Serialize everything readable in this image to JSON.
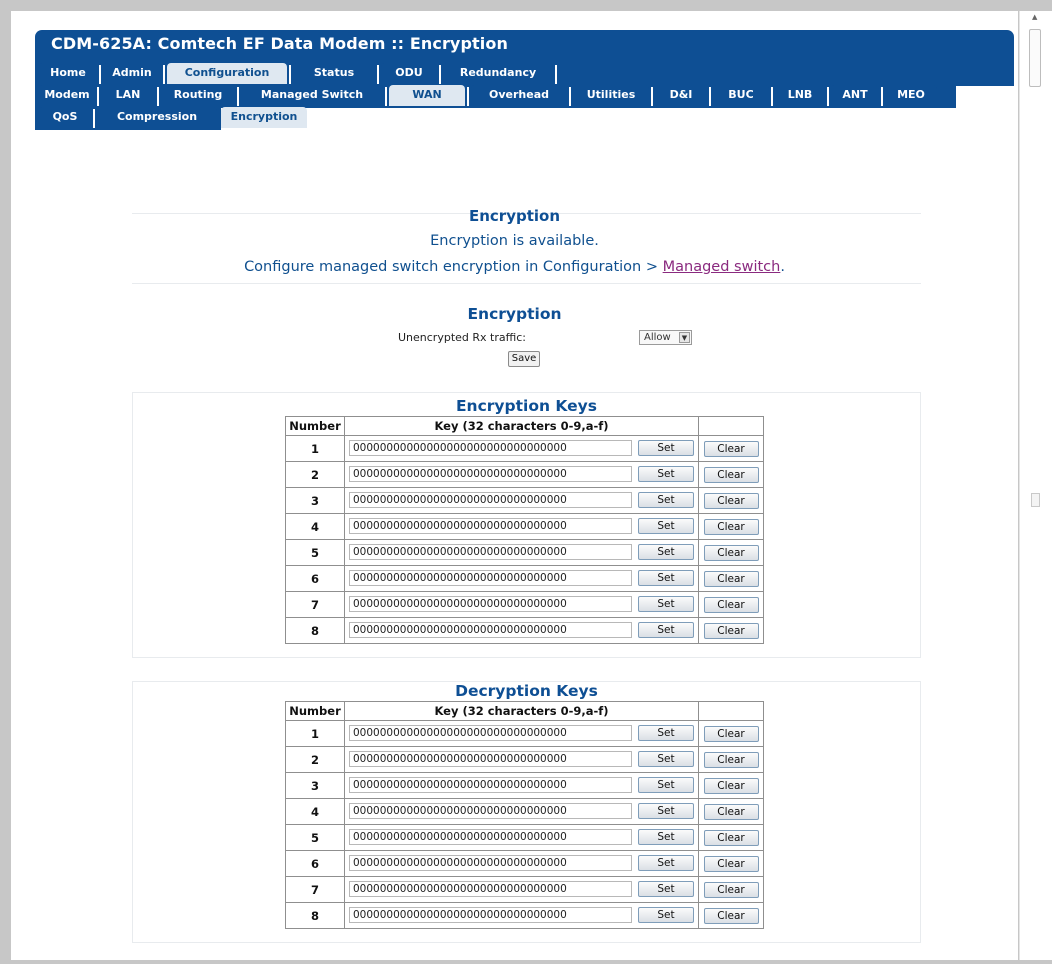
{
  "header": {
    "title": "CDM-625A: Comtech EF Data Modem :: Encryption",
    "tabs_row1": [
      "Home",
      "Admin",
      "Configuration",
      "Status",
      "ODU",
      "Redundancy"
    ],
    "tabs_row2": [
      "Modem",
      "LAN",
      "Routing",
      "Managed Switch",
      "WAN",
      "Overhead",
      "Utilities",
      "D&I",
      "BUC",
      "LNB",
      "ANT",
      "MEO"
    ],
    "tabs_row3": [
      "QoS",
      "Compression",
      "Encryption"
    ],
    "active": {
      "row1": "Configuration",
      "row2": "WAN",
      "row3": "Encryption"
    }
  },
  "status": {
    "heading": "Encryption",
    "available_text": "Encryption is available.",
    "configure_prefix": "Configure managed switch encryption in Configuration > ",
    "configure_link": "Managed switch",
    "configure_suffix": "."
  },
  "settings": {
    "heading": "Encryption",
    "rx_label": "Unencrypted Rx traffic:",
    "rx_value": "Allow",
    "save_label": "Save"
  },
  "encryption_keys": {
    "title": "Encryption Keys",
    "col_number": "Number",
    "col_key": "Key (32 characters 0-9,a-f)",
    "rows": [
      {
        "number": "1",
        "key": "00000000000000000000000000000000"
      },
      {
        "number": "2",
        "key": "00000000000000000000000000000000"
      },
      {
        "number": "3",
        "key": "00000000000000000000000000000000"
      },
      {
        "number": "4",
        "key": "00000000000000000000000000000000"
      },
      {
        "number": "5",
        "key": "00000000000000000000000000000000"
      },
      {
        "number": "6",
        "key": "00000000000000000000000000000000"
      },
      {
        "number": "7",
        "key": "00000000000000000000000000000000"
      },
      {
        "number": "8",
        "key": "00000000000000000000000000000000"
      }
    ]
  },
  "decryption_keys": {
    "title": "Decryption Keys",
    "col_number": "Number",
    "col_key": "Key (32 characters 0-9,a-f)",
    "rows": [
      {
        "number": "1",
        "key": "00000000000000000000000000000000"
      },
      {
        "number": "2",
        "key": "00000000000000000000000000000000"
      },
      {
        "number": "3",
        "key": "00000000000000000000000000000000"
      },
      {
        "number": "4",
        "key": "00000000000000000000000000000000"
      },
      {
        "number": "5",
        "key": "00000000000000000000000000000000"
      },
      {
        "number": "6",
        "key": "00000000000000000000000000000000"
      },
      {
        "number": "7",
        "key": "00000000000000000000000000000000"
      },
      {
        "number": "8",
        "key": "00000000000000000000000000000000"
      }
    ]
  },
  "buttons": {
    "set_label": "Set",
    "clear_label": "Clear"
  },
  "colors": {
    "brand_blue": "#0e4f94",
    "active_tab": "#dfe8f1",
    "link_visited": "#8a2a7f"
  }
}
